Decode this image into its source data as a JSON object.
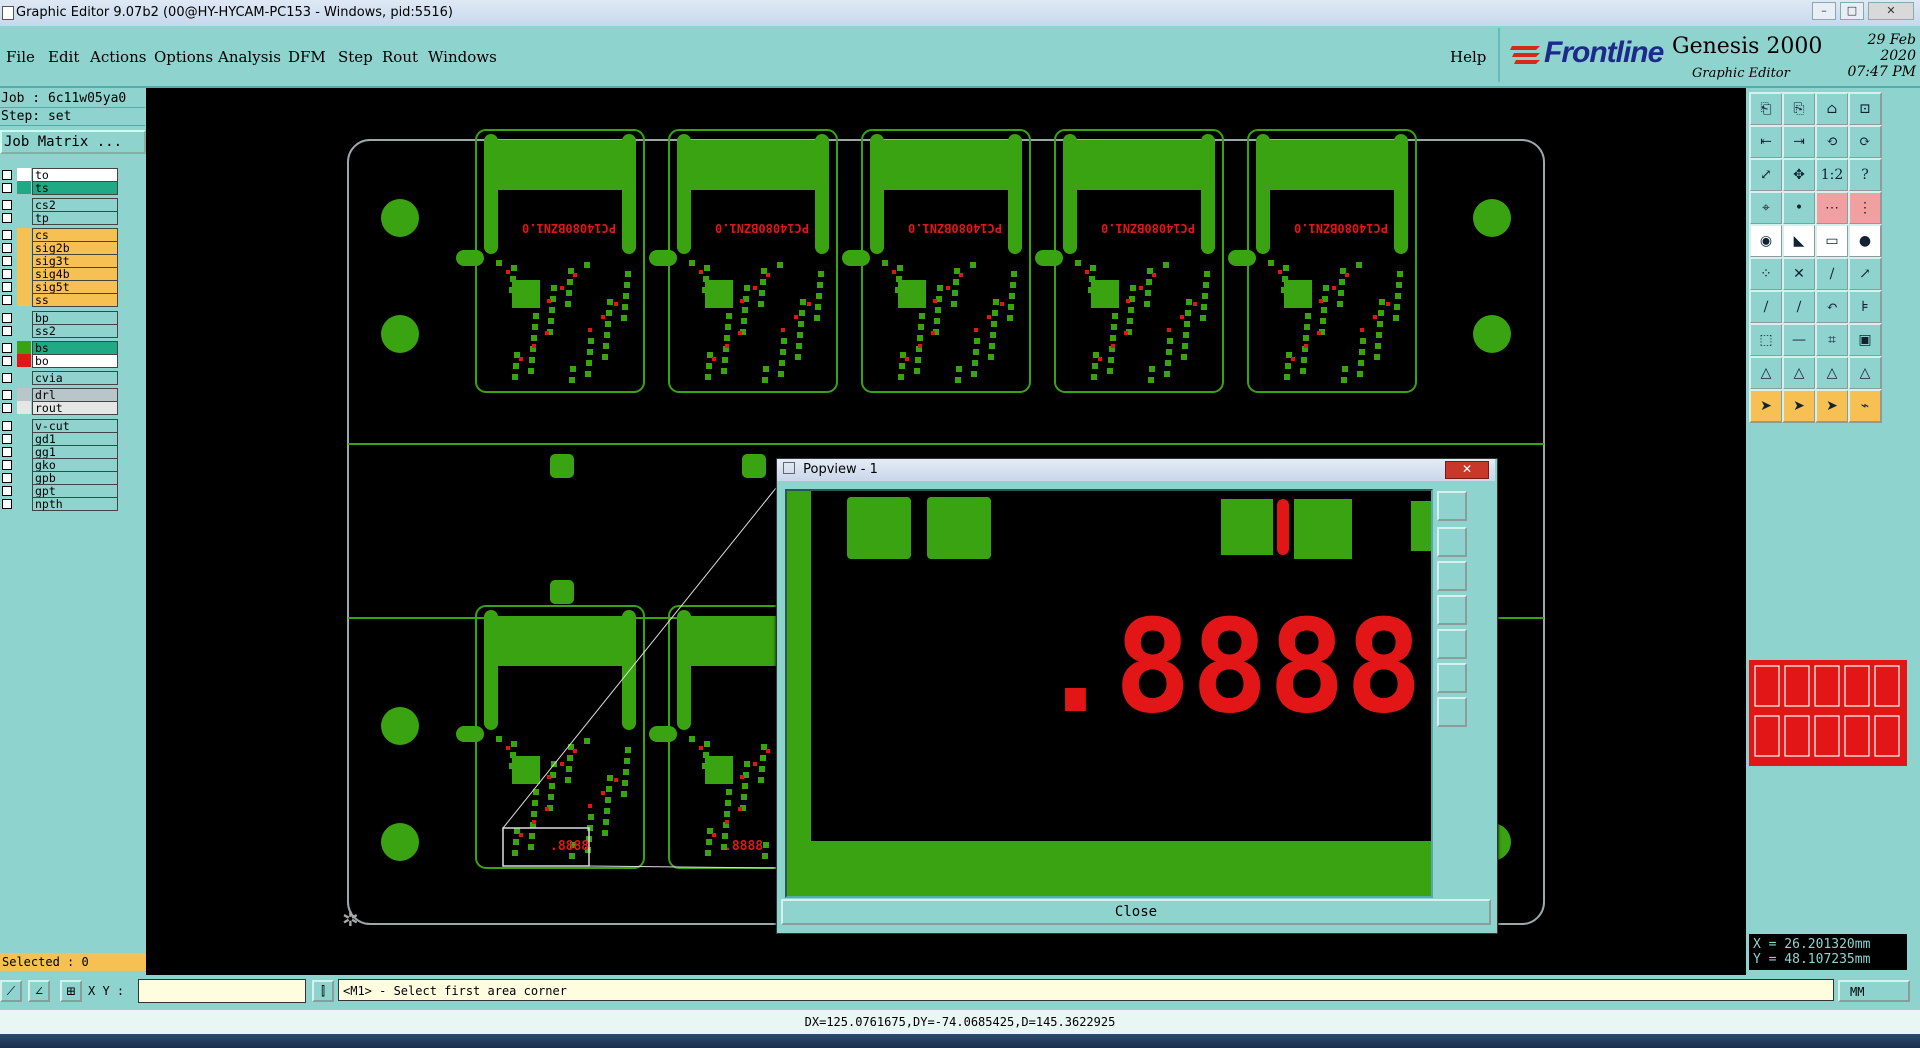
{
  "window": {
    "title": "Graphic Editor 9.07b2 (00@HY-HYCAM-PC153 - Windows, pid:5516)"
  },
  "menu": {
    "items": [
      "File",
      "Edit",
      "Actions",
      "Options",
      "Analysis",
      "DFM",
      "Step",
      "Rout",
      "Windows"
    ],
    "help": "Help"
  },
  "brand": {
    "logo": "Frontline",
    "product": "Genesis 2000",
    "subtitle": "Graphic Editor",
    "date": "29 Feb 2020",
    "time": "07:47 PM"
  },
  "job": {
    "job_line": "Job : 6c11w05ya0",
    "step_line": "Step: set",
    "matrix_button": "Job Matrix ..."
  },
  "layers": [
    {
      "name": "to",
      "color": "#ffffff",
      "swatch": "#ffffff"
    },
    {
      "name": "ts",
      "color": "#1faa85",
      "swatch": "#1faa85"
    },
    {
      "name": "cs2",
      "color": "#8fd3cf",
      "swatch": "#8fd3cf"
    },
    {
      "name": "tp",
      "color": "#8fd3cf",
      "swatch": "#8fd3cf"
    },
    {
      "name": "cs",
      "color": "#f6c052",
      "swatch": "#f6c052"
    },
    {
      "name": "sig2b",
      "color": "#f6c052",
      "swatch": "#f6c052"
    },
    {
      "name": "sig3t",
      "color": "#f6c052",
      "swatch": "#f6c052"
    },
    {
      "name": "sig4b",
      "color": "#f6c052",
      "swatch": "#f6c052"
    },
    {
      "name": "sig5t",
      "color": "#f6c052",
      "swatch": "#f6c052"
    },
    {
      "name": "ss",
      "color": "#f6c052",
      "swatch": "#f6c052"
    },
    {
      "name": "bp",
      "color": "#8fd3cf",
      "swatch": "#8fd3cf"
    },
    {
      "name": "ss2",
      "color": "#8fd3cf",
      "swatch": "#8fd3cf"
    },
    {
      "name": "bs",
      "color": "#1faa85",
      "swatch": "#3aa312"
    },
    {
      "name": "bo",
      "color": "#ffffff",
      "swatch": "#e21616"
    },
    {
      "name": "cvia",
      "color": "#8fd3cf",
      "swatch": "#8fd3cf"
    },
    {
      "name": "drl",
      "color": "#b9c6c9",
      "swatch": "#b9c6c9"
    },
    {
      "name": "rout",
      "color": "#e6e6e6",
      "swatch": "#e6e6e6"
    },
    {
      "name": "v-cut",
      "color": "#8fd3cf",
      "swatch": "#8fd3cf"
    },
    {
      "name": "gd1",
      "color": "#8fd3cf",
      "swatch": "#8fd3cf"
    },
    {
      "name": "gg1",
      "color": "#8fd3cf",
      "swatch": "#8fd3cf"
    },
    {
      "name": "gko",
      "color": "#8fd3cf",
      "swatch": "#8fd3cf"
    },
    {
      "name": "gpb",
      "color": "#8fd3cf",
      "swatch": "#8fd3cf"
    },
    {
      "name": "gpt",
      "color": "#8fd3cf",
      "swatch": "#8fd3cf"
    },
    {
      "name": "npth",
      "color": "#8fd3cf",
      "swatch": "#8fd3cf"
    }
  ],
  "status": {
    "selected": "Selected : 0",
    "xy_label": "X Y :",
    "prompt": "<M1> - Select first area corner",
    "unit": "MM",
    "measure": "DX=125.0761675,DY=-74.0685425,D=145.3622925"
  },
  "coords": {
    "x": "X = 26.201320mm",
    "y": "Y = 48.107235mm"
  },
  "board": {
    "label_text": "PC14080BZN1.0",
    "zoom_label": ".8888"
  },
  "popview": {
    "title": "Popview - 1",
    "close_label": "Close",
    "big_label": ".8888"
  },
  "colors": {
    "panel": "#8fd3cf",
    "board_green": "#3aa312",
    "silk_red": "#e21616",
    "outline": "#9aa"
  }
}
